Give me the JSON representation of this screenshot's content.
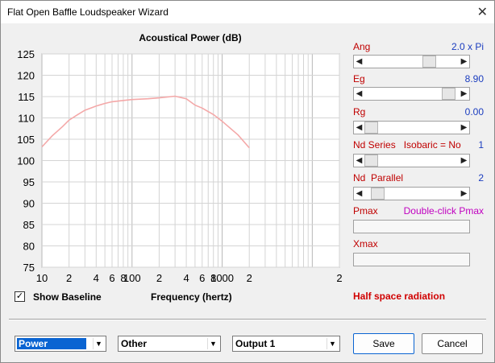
{
  "window": {
    "title": "Flat Open Baffle Loudspeaker Wizard",
    "close_glyph": "✕"
  },
  "chart_data": {
    "type": "line",
    "title": "Acoustical Power (dB)",
    "xlabel": "Frequency (hertz)",
    "ylabel": "",
    "xscale": "log",
    "xlim": [
      10,
      20000
    ],
    "ylim": [
      75,
      125
    ],
    "yticks": [
      "125",
      "120",
      "115",
      "110",
      "105",
      "100",
      "95",
      "90",
      "85",
      "80",
      "75"
    ],
    "xtick_labels": [
      {
        "f": 10,
        "label": "10"
      },
      {
        "f": 20,
        "label": "2"
      },
      {
        "f": 40,
        "label": "4"
      },
      {
        "f": 60,
        "label": "6"
      },
      {
        "f": 80,
        "label": "8"
      },
      {
        "f": 100,
        "label": "100"
      },
      {
        "f": 200,
        "label": "2"
      },
      {
        "f": 400,
        "label": "4"
      },
      {
        "f": 600,
        "label": "6"
      },
      {
        "f": 800,
        "label": "8"
      },
      {
        "f": 1000,
        "label": "1000"
      },
      {
        "f": 2000,
        "label": "2"
      }
    ],
    "grid": true,
    "series": [
      {
        "color": "#f4a8a8",
        "x": [
          10,
          13,
          17,
          20,
          25,
          30,
          40,
          50,
          60,
          80,
          100,
          150,
          200,
          300,
          400,
          500,
          600,
          800,
          1000,
          1500,
          2000
        ],
        "y": [
          103.2,
          105.8,
          108.0,
          109.5,
          110.8,
          111.8,
          112.8,
          113.4,
          113.8,
          114.1,
          114.3,
          114.5,
          114.7,
          115.1,
          114.5,
          113.0,
          112.3,
          110.8,
          109.2,
          106.0,
          103.0
        ]
      }
    ]
  },
  "show_baseline": {
    "label": "Show Baseline",
    "checked": true,
    "check_glyph": "✓"
  },
  "params": {
    "ang": {
      "label": "Ang",
      "value": "2.0 x Pi",
      "level": 0.72
    },
    "eg": {
      "label": "Eg",
      "value": "8.90",
      "level": 0.96
    },
    "rg": {
      "label": "Rg",
      "value": "0.00",
      "level": 0.0
    },
    "nds": {
      "label": "Nd Series   Isobaric = No",
      "value": "1",
      "level": 0.0
    },
    "ndp": {
      "label": "Nd  Parallel",
      "value": "2",
      "level": 0.08
    },
    "pmax": {
      "label": "Pmax",
      "value": "Double-click Pmax",
      "value_color": "#c000c0"
    },
    "xmax": {
      "label": "Xmax",
      "value": ""
    }
  },
  "status": {
    "half_space": "Half space radiation"
  },
  "bottom": {
    "combo1": "Power",
    "combo2": "Other",
    "combo3": "Output 1",
    "save": "Save",
    "cancel": "Cancel"
  }
}
